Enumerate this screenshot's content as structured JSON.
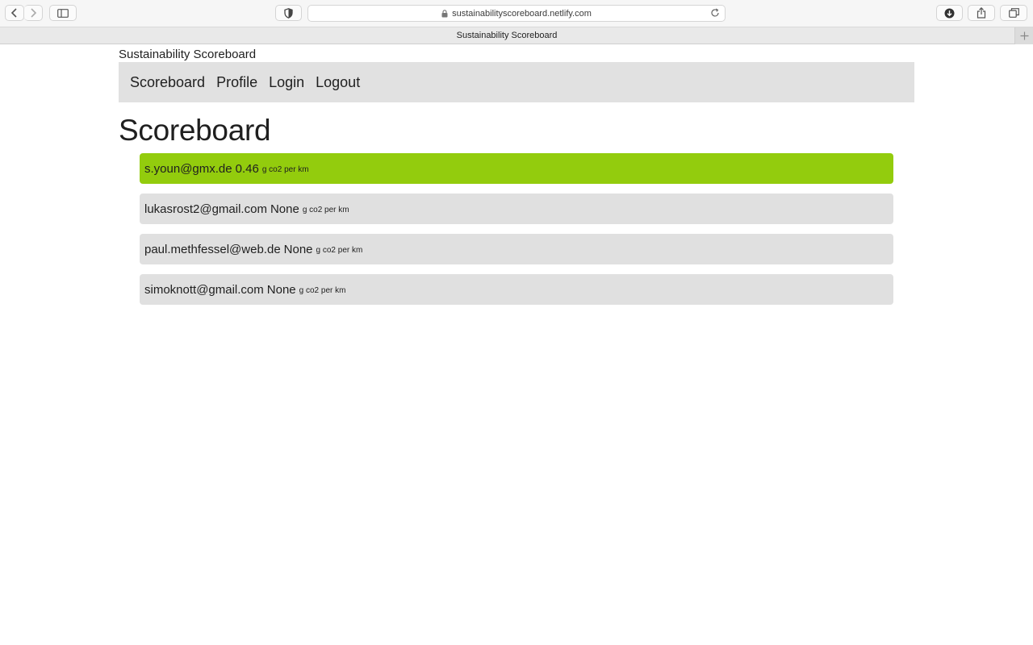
{
  "browser": {
    "url": "sustainabilityscoreboard.netlify.com",
    "tab_title": "Sustainability Scoreboard"
  },
  "site": {
    "title": "Sustainability Scoreboard"
  },
  "nav": {
    "items": [
      "Scoreboard",
      "Profile",
      "Login",
      "Logout"
    ]
  },
  "main": {
    "heading": "Scoreboard",
    "unit": "g co2 per km",
    "entries": [
      {
        "email": "s.youn@gmx.de",
        "value": "0.46"
      },
      {
        "email": "lukasrost2@gmail.com",
        "value": "None"
      },
      {
        "email": "paul.methfessel@web.de",
        "value": "None"
      },
      {
        "email": "simoknott@gmail.com",
        "value": "None"
      }
    ]
  },
  "colors": {
    "leader": "#93cc0d",
    "row": "#e0e0e0",
    "nav": "#e1e1e1"
  }
}
